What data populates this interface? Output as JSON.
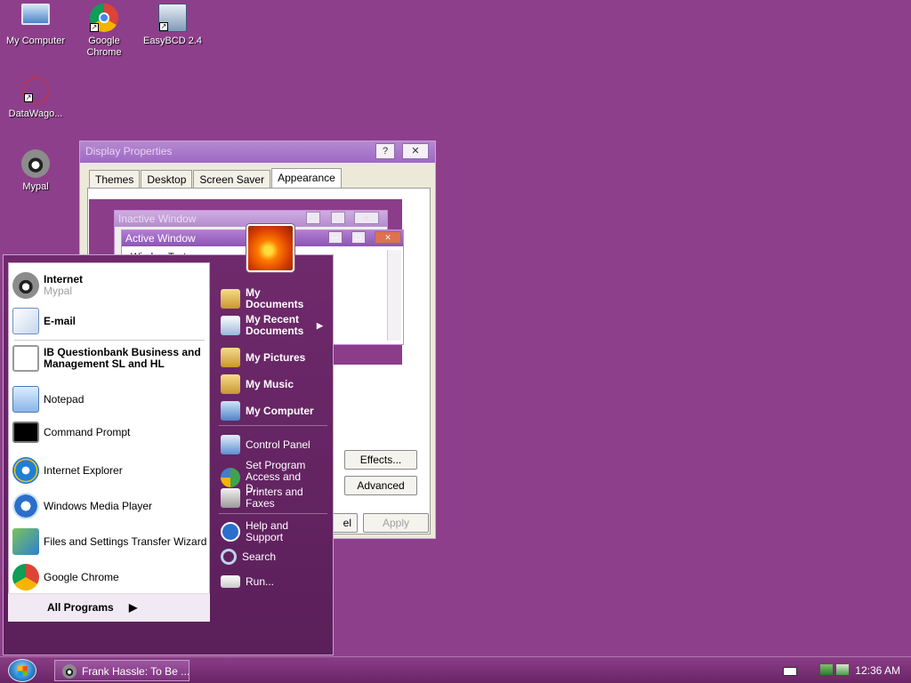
{
  "desktop": {
    "icons": [
      {
        "label": "My Computer"
      },
      {
        "label": "Google Chrome"
      },
      {
        "label": "EasyBCD 2.4"
      },
      {
        "label": "DataWago..."
      },
      {
        "label": "Mypal"
      }
    ]
  },
  "display_properties": {
    "title": "Display Properties",
    "help_btn": "?",
    "close_btn": "✕",
    "tabs": [
      "Themes",
      "Desktop",
      "Screen Saver",
      "Appearance"
    ],
    "active_tab": "Appearance",
    "preview": {
      "inactive_title": "Inactive Window",
      "active_title": "Active Window",
      "window_text": "Window Text"
    },
    "buttons": {
      "effects": "Effects...",
      "advanced": "Advanced",
      "cancel": "el",
      "apply": "Apply"
    }
  },
  "start_menu": {
    "pinned": [
      {
        "label": "Internet",
        "sub": "Mypal"
      },
      {
        "label": "E-mail"
      }
    ],
    "recent": [
      {
        "label": "IB Questionbank Business and Management SL and HL"
      },
      {
        "label": "Notepad"
      },
      {
        "label": "Command Prompt"
      },
      {
        "label": "Internet Explorer"
      },
      {
        "label": "Windows Media Player"
      },
      {
        "label": "Files and Settings Transfer Wizard"
      },
      {
        "label": "Google Chrome"
      }
    ],
    "all_programs": "All Programs",
    "right": [
      {
        "label": "My Documents"
      },
      {
        "label": "My Recent Documents"
      },
      {
        "label": "My Pictures"
      },
      {
        "label": "My Music"
      },
      {
        "label": "My Computer"
      },
      {
        "label": "Control Panel"
      },
      {
        "label": "Set Program Access and D..."
      },
      {
        "label": "Printers and Faxes"
      },
      {
        "label": "Help and Support"
      },
      {
        "label": "Search"
      },
      {
        "label": "Run..."
      }
    ]
  },
  "taskbar": {
    "task": "Frank Hassle: To Be ...",
    "clock": "12:36 AM"
  }
}
